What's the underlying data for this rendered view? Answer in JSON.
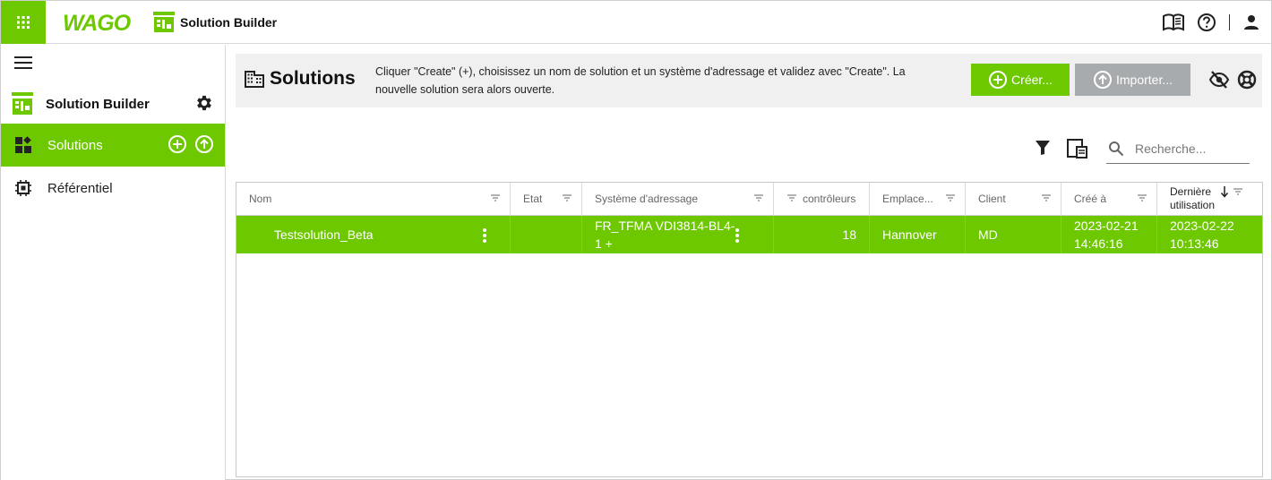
{
  "header": {
    "brand": "WAGO",
    "app_title": "Solution Builder"
  },
  "sidebar": {
    "title": "Solution Builder",
    "items": [
      {
        "label": "Solutions",
        "active": true
      },
      {
        "label": "Référentiel",
        "active": false
      }
    ]
  },
  "banner": {
    "title": "Solutions",
    "description": "Cliquer \"Create\" (+), choisissez un nom de solution et un système d'adressage et validez avec \"Create\". La nouvelle solution sera alors ouverte.",
    "create_label": "Créer...",
    "import_label": "Importer..."
  },
  "search": {
    "placeholder": "Recherche..."
  },
  "table": {
    "columns": [
      {
        "label": "Nom"
      },
      {
        "label": "Etat"
      },
      {
        "label": "Système d'adressage"
      },
      {
        "label": "contrôleurs"
      },
      {
        "label": "Emplace..."
      },
      {
        "label": "Client"
      },
      {
        "label": "Créé à"
      },
      {
        "label_line1": "Dernière",
        "label_line2": "utilisation",
        "sort": "descending"
      }
    ],
    "rows": [
      {
        "name": "Testsolution_Beta",
        "state": "",
        "addressing_line1": "FR_TFMA VDI3814-BL4-",
        "addressing_line2": "1 +",
        "controllers": "18",
        "location": "Hannover",
        "client": "MD",
        "created_date": "2023-02-21",
        "created_time": "14:46:16",
        "last_used_date": "2023-02-22",
        "last_used_time": "10:13:46"
      }
    ]
  },
  "colors": {
    "accent": "#6ec800",
    "disabled": "#a8abad"
  }
}
